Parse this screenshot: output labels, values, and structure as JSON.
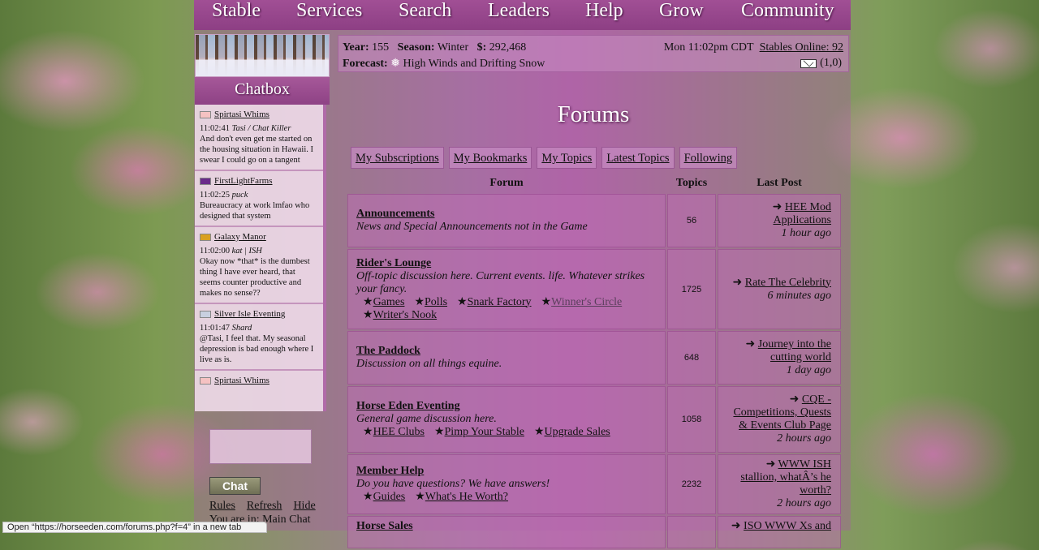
{
  "nav": [
    "Stable",
    "Services",
    "Search",
    "Leaders",
    "Help",
    "Grow",
    "Community"
  ],
  "chat": {
    "title": "Chatbox",
    "messages": [
      {
        "name": "Spirtasi Whims",
        "flag": "#f5c2c2",
        "time": "11:02:41",
        "nick": "Tasi / Chat Killer",
        "text": "And don't even get me started on the housing situation in Hawaii. I swear I could go on a tangent"
      },
      {
        "name": "FirstLightFarms",
        "flag": "#6a2a8a",
        "time": "11:02:25",
        "nick": "puck",
        "text": "Bureaucracy at work lmfao who designed that system"
      },
      {
        "name": "Galaxy Manor",
        "flag": "#d9a020",
        "time": "11:02:00",
        "nick": "kat | ISH",
        "text": "Okay now *that* is the dumbest thing I have ever heard, that seems counter productive and makes no sense??"
      },
      {
        "name": "Silver Isle Eventing",
        "flag": "#c8d0e0",
        "time": "11:01:47",
        "nick": "Shard",
        "text": "@Tasi, I feel that. My seasonal depression is bad enough where I live as is."
      },
      {
        "name": "Spirtasi Whims",
        "flag": "#f5c2c2",
        "time": "",
        "nick": "",
        "text": ""
      }
    ],
    "button": "Chat",
    "links": [
      "Rules",
      "Refresh",
      "Hide"
    ],
    "location": "You are in: Main Chat"
  },
  "status": {
    "year_label": "Year:",
    "year": "155",
    "season_label": "Season:",
    "season": "Winter",
    "money_label": "$:",
    "money": "292,468",
    "forecast_label": "Forecast:",
    "forecast": "High Winds and Drifting Snow",
    "time": "Mon 11:02pm CDT",
    "online": "Stables Online: 92",
    "mail": "(1,0)"
  },
  "page_title": "Forums",
  "tabs": [
    "My Subscriptions",
    "My Bookmarks",
    "My Topics",
    "Latest Topics",
    "Following"
  ],
  "table": {
    "headers": [
      "Forum",
      "Topics",
      "Last Post"
    ],
    "rows": [
      {
        "title": "Announcements",
        "desc": "News and Special Announcements not in the Game",
        "subs": [],
        "topics": "56",
        "last": "HEE Mod Applications",
        "ago": "1 hour ago"
      },
      {
        "title": "Rider's Lounge",
        "desc": "Off-topic discussion here. Current events. life. Whatever strikes your fancy.",
        "subs": [
          "Games",
          "Polls",
          "Snark Factory",
          "Winner's Circle",
          "Writer's Nook"
        ],
        "topics": "1725",
        "last": "Rate The Celebrity",
        "ago": "6 minutes ago"
      },
      {
        "title": "The Paddock",
        "desc": "Discussion on all things equine.",
        "subs": [],
        "topics": "648",
        "last": "Journey into the cutting world",
        "ago": "1 day ago"
      },
      {
        "title": "Horse Eden Eventing",
        "desc": "General game discussion here.",
        "subs": [
          "HEE Clubs",
          "Pimp Your Stable",
          "Upgrade Sales"
        ],
        "topics": "1058",
        "last": "CQE - Competitions, Quests & Events Club Page",
        "ago": "2 hours ago"
      },
      {
        "title": "Member Help",
        "desc": "Do you have questions? We have answers!",
        "subs": [
          "Guides",
          "What's He Worth?"
        ],
        "topics": "2232",
        "last": "WWW ISH stallion, whatÂ’s he worth?",
        "ago": "2 hours ago"
      },
      {
        "title": "Horse Sales",
        "desc": "",
        "subs": [],
        "topics": "",
        "last": "ISO WWW Xs and",
        "ago": ""
      }
    ]
  },
  "browser_status": "Open “https://horseeden.com/forums.php?f=4” in a new tab"
}
